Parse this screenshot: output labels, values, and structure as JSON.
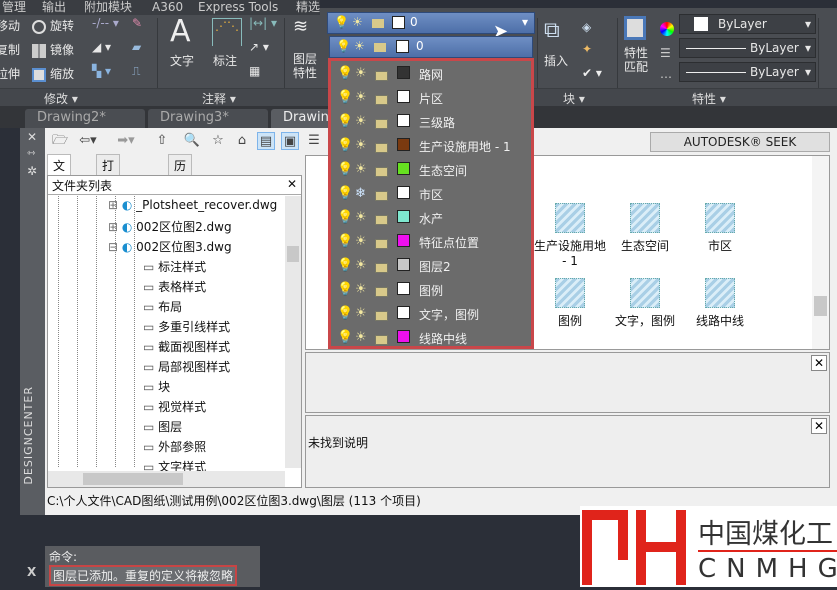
{
  "menu": [
    "管理",
    "输出",
    "附加模块",
    "A360",
    "Express Tools",
    "精选应用"
  ],
  "ribbon": {
    "modify": {
      "title": "修改",
      "items": [
        "移动",
        "旋转",
        "复制",
        "镜像",
        "拉伸",
        "缩放"
      ]
    },
    "annotation": {
      "title": "注释",
      "text": "文字",
      "dim": "标注"
    },
    "layers": {
      "layer_props": "图层\n特性",
      "current_layer": "0"
    },
    "block": {
      "title": "块",
      "insert": "插入"
    },
    "properties": {
      "title": "特性",
      "match": "特性\n匹配",
      "color": "ByLayer",
      "linetype": "ByLayer",
      "lineweight": "ByLayer"
    }
  },
  "doc_tabs": [
    "Drawing2*",
    "Drawing3*",
    "Drawing"
  ],
  "layer_dropdown": {
    "selected": "0",
    "layers": [
      {
        "name": "路网",
        "color": "#333333",
        "frozen": false
      },
      {
        "name": "片区",
        "color": "#ffffff",
        "frozen": false
      },
      {
        "name": "三级路",
        "color": "#ffffff",
        "frozen": false
      },
      {
        "name": "生产设施用地 - 1",
        "color": "#7a3a10",
        "frozen": false
      },
      {
        "name": "生态空间",
        "color": "#66e020",
        "frozen": false
      },
      {
        "name": "市区",
        "color": "#ffffff",
        "frozen": true
      },
      {
        "name": "水产",
        "color": "#7fe8cf",
        "frozen": false
      },
      {
        "name": "特征点位置",
        "color": "#ee10ee",
        "frozen": false
      },
      {
        "name": "图层2",
        "color": "#c8c8c8",
        "frozen": false
      },
      {
        "name": "图例",
        "color": "#ffffff",
        "frozen": false
      },
      {
        "name": "文字，图例",
        "color": "#ffffff",
        "frozen": false
      },
      {
        "name": "线路中线",
        "color": "#ee10ee",
        "frozen": false
      }
    ]
  },
  "designcenter": {
    "strip_label": "DESIGNCENTER",
    "seek": "AUTODESK® SEEK",
    "tabs": [
      "文件夹",
      "打开的图形",
      "历史记录"
    ],
    "tree_title": "文件夹列表",
    "tree": [
      "_Plotsheet_recover.dwg",
      "002区位图2.dwg",
      "002区位图3.dwg",
      "标注样式",
      "表格样式",
      "布局",
      "多重引线样式",
      "截面视图样式",
      "局部视图样式",
      "块",
      "视觉样式",
      "图层",
      "外部参照",
      "文字样式"
    ],
    "content_items": [
      "生产设施用地 - 1",
      "生态空间",
      "市区",
      "图例",
      "文字，图例",
      "线路中线"
    ],
    "description": "未找到说明",
    "path": "C:\\个人文件\\CAD图纸\\测试用例\\002区位图3.dwg\\图层 (113 个项目)"
  },
  "command": {
    "line1": "命令:",
    "line2": "图层已添加。重复的定义将被忽略"
  },
  "watermark": {
    "cn": "中国煤化工",
    "en": "CNMHG"
  }
}
